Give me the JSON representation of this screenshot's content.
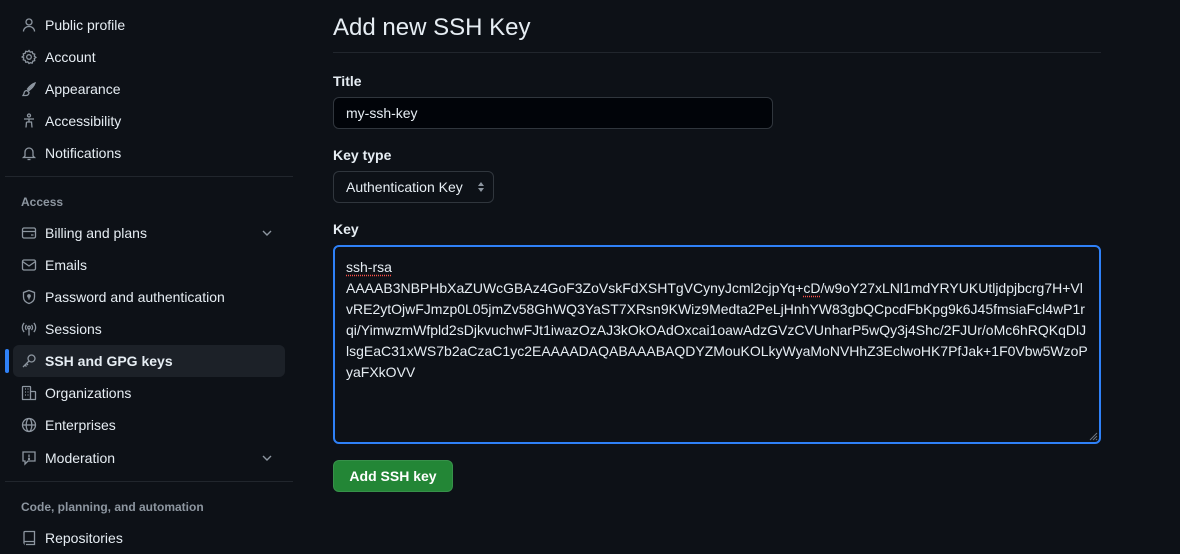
{
  "sidebar": {
    "items_top": [
      {
        "label": "Public profile",
        "icon": "person-icon"
      },
      {
        "label": "Account",
        "icon": "gear-icon"
      },
      {
        "label": "Appearance",
        "icon": "paintbrush-icon"
      },
      {
        "label": "Accessibility",
        "icon": "accessibility-icon"
      },
      {
        "label": "Notifications",
        "icon": "bell-icon"
      }
    ],
    "access_section_label": "Access",
    "items_access": [
      {
        "label": "Billing and plans",
        "icon": "credit-card-icon",
        "expandable": true
      },
      {
        "label": "Emails",
        "icon": "mail-icon"
      },
      {
        "label": "Password and authentication",
        "icon": "shield-lock-icon"
      },
      {
        "label": "Sessions",
        "icon": "broadcast-icon"
      },
      {
        "label": "SSH and GPG keys",
        "icon": "key-icon",
        "active": true
      },
      {
        "label": "Organizations",
        "icon": "organization-icon"
      },
      {
        "label": "Enterprises",
        "icon": "globe-icon"
      },
      {
        "label": "Moderation",
        "icon": "report-icon",
        "expandable": true
      }
    ],
    "code_section_label": "Code, planning, and automation",
    "items_code": [
      {
        "label": "Repositories",
        "icon": "repo-icon"
      }
    ]
  },
  "main": {
    "title": "Add new SSH Key",
    "title_field": {
      "label": "Title",
      "value": "my-ssh-key"
    },
    "key_type_field": {
      "label": "Key type",
      "selected": "Authentication Key"
    },
    "key_field": {
      "label": "Key",
      "prefix": "ssh-rsa",
      "value_line1": "AAAAB3NBPHbXaZUWcGBAz4GoF3ZoVskFdXSHTgVCynyJcml2cjpYq+",
      "value_squiggle": "cD",
      "value_rest": "/w9oY27xLNl1mdYRYUKUtljdpjbcrg7H+VlvRE2ytOjwFJmzp0L05jmZv58GhWQ3YaST7XRsn9KWiz9Medta2PeLjHnhYW83gbQCpcdFbKpg9k6J45fmsiaFcl4wP1rqi/YimwzmWfpld2sDjkvuchwFJt1iwazOzAJ3kOkOAdOxcai1oawAdzGVzCVUnharP5wQy3j4Shc/2FJUr/oMc6hRQKqDlJlsgEaC31xWS7b2aCzaC1yc2EAAAADAQABAAABAQDYZMouKOLkyWyaMoNVHhZ3EclwoHK7PfJak+1F0Vbw5WzoPyaFXkOVV"
    },
    "submit_label": "Add SSH key"
  },
  "colors": {
    "background": "#0d1117",
    "accent_blue": "#2f81f7",
    "button_green": "#238636",
    "muted_text": "#8d96a0"
  }
}
